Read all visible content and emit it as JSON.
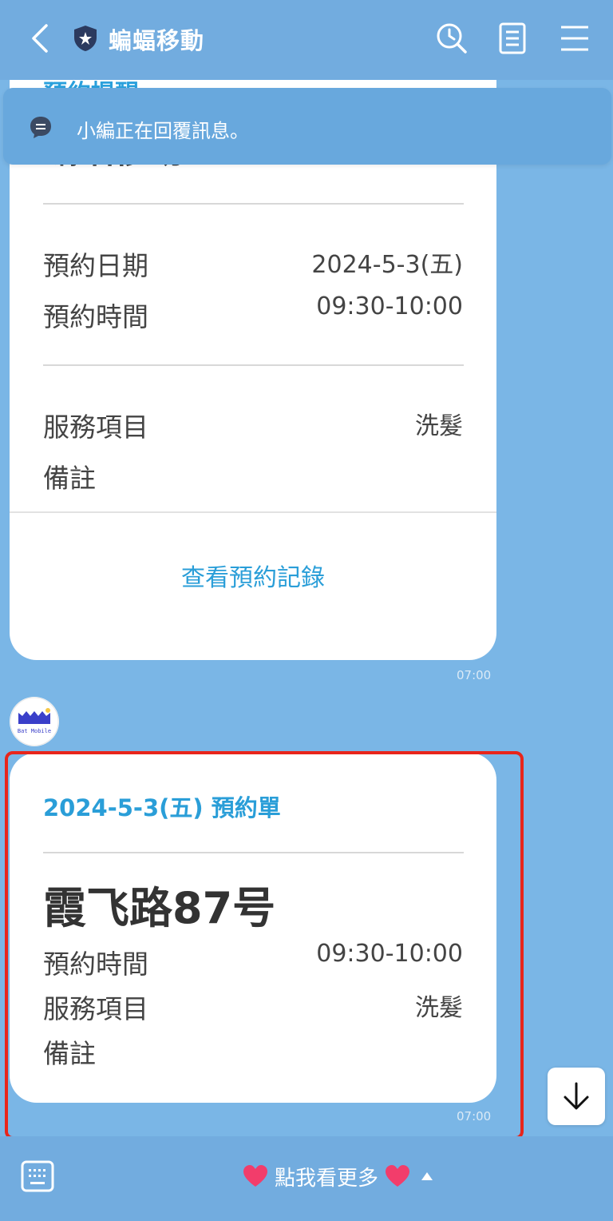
{
  "header": {
    "title": "蝙蝠移動"
  },
  "banner": {
    "text": "小編正在回覆訊息。"
  },
  "card1": {
    "partial_title": "預約提醒",
    "store": "蝙蝠移動",
    "date_label": "預約日期",
    "date_value": "2024-5-3(五)",
    "time_label": "預約時間",
    "time_value": "09:30-10:00",
    "service_label": "服務項目",
    "service_value": "洗髮",
    "note_label": "備註",
    "link": "查看預約記錄",
    "timestamp": "07:00"
  },
  "avatar": {
    "text": "Bat Mobile"
  },
  "card2": {
    "heading": "2024-5-3(五) 預約單",
    "address": "霞飞路87号",
    "time_label": "預約時間",
    "time_value": "09:30-10:00",
    "service_label": "服務項目",
    "service_value": "洗髮",
    "note_label": "備註",
    "timestamp": "07:00"
  },
  "footer": {
    "menu_label": "點我看更多"
  },
  "colors": {
    "background": "#7ab6e6",
    "header": "#72acdf",
    "accent": "#2a9ed8",
    "highlight": "#e8251b",
    "heart": "#f23d6b"
  },
  "icons": [
    "back-icon",
    "shield-icon",
    "clock-search-icon",
    "notes-icon",
    "menu-icon",
    "chat-bubble-icon",
    "arrow-down-icon",
    "keyboard-icon",
    "heart-icon",
    "caret-up-icon"
  ]
}
